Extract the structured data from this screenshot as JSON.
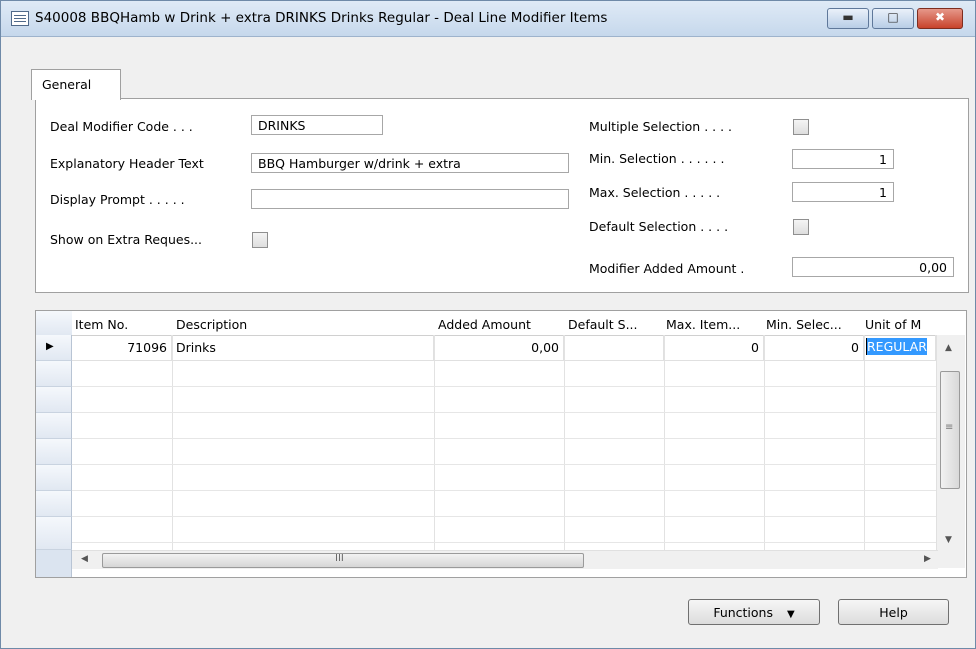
{
  "window": {
    "title": "S40008 BBQHamb w Drink + extra DRINKS Drinks Regular - Deal Line Modifier Items"
  },
  "tabs": [
    {
      "label": "General"
    }
  ],
  "general": {
    "deal_modifier_code_label": "Deal Modifier Code . . .",
    "deal_modifier_code_value": "DRINKS",
    "explanatory_header_text_label": "Explanatory Header Text",
    "explanatory_header_text_value": "BBQ Hamburger w/drink + extra",
    "display_prompt_label": "Display Prompt . . . . .",
    "display_prompt_value": "",
    "show_on_extra_request_label": "Show on Extra Reques...",
    "multiple_selection_label": "Multiple Selection . . . .",
    "min_selection_label": "Min. Selection . . . . . .",
    "min_selection_value": "1",
    "max_selection_label": "Max. Selection . . . . .",
    "max_selection_value": "1",
    "default_selection_label": "Default Selection . . . .",
    "modifier_added_amount_label": "Modifier Added Amount .",
    "modifier_added_amount_value": "0,00"
  },
  "grid": {
    "columns": [
      "Item No.",
      "Description",
      "Added Amount",
      "Default S...",
      "Max. Item...",
      "Min. Selec...",
      "Unit of M"
    ],
    "rows": [
      [
        "71096",
        "Drinks",
        "0,00",
        "",
        "0",
        "0",
        "REGULAR"
      ]
    ],
    "hscroll_grip": "III"
  },
  "buttons": {
    "functions": "Functions",
    "help": "Help"
  }
}
